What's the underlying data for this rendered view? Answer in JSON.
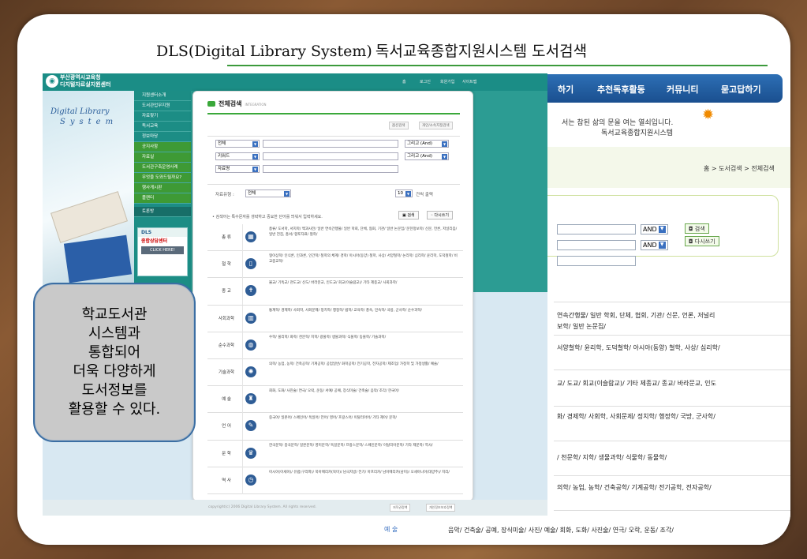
{
  "slide": {
    "title_en": "DLS(Digital Library System)",
    "title_ko": "독서교육종합지원시스템 도서검색"
  },
  "background_site": {
    "nav": [
      "하기",
      "추천독후활동",
      "커뮤니티",
      "묻고답하기"
    ],
    "greeting_line1": "서는 참된 삶의 문을 여는 열쇠입니다.",
    "greeting_line2": "독서교육종합지원시스템",
    "breadcrumb": "홈 > 도서검색 > 전체검색",
    "and_label": "AND",
    "search_btn": "검색",
    "rewrite_btn": "다시쓰기",
    "rows": [
      "연속간행물/ 일반 학회, 단체, 협회, 기관/ 신문, 언론, 저널리",
      "보학/ 일반 논문집/",
      "서양철학/ 윤리학, 도덕철학/ 아시아(동양) 철학, 사상/ 심리학/",
      "교/ 도교/ 회교(이슬람교)/ 기타 제종교/ 종교/ 바라문교, 인도",
      "화/ 경제학/ 사회학, 사회문제/ 정치학/ 행정학/ 국방, 군사학/",
      "/ 천문학/ 지학/ 생물과학/ 식물학/ 동물학/",
      "의학/ 농업, 농학/ 건축공학/ 기계공학/ 전기공학, 전자공학/"
    ],
    "art_label": "예 술",
    "art_row": "음악/ 건축술/ 공예, 장식미술/ 사진/ 예술/ 회화, 도화/ 사진술/ 연극/ 오락, 운동/ 조각/"
  },
  "screenshot": {
    "logo_line1": "부산광역시교육청",
    "logo_line2": "디지털자료실지원센터",
    "utility_links": [
      "홈",
      "로그인",
      "회원가입",
      "사이트맵"
    ],
    "hero_line1": "Digital Library",
    "hero_line2": "System",
    "menu_main": [
      "지원센터소개",
      "도서관업무지원",
      "자료찾기",
      "독서교육",
      "정보마당"
    ],
    "menu_sub": [
      "공지사항",
      "자료실",
      "도서관구축운영사례",
      "무엇을 도와드릴까요?",
      "행사게시판",
      "플랜터",
      "토론방"
    ],
    "dls_title": "DLS",
    "dls_sub": "종합상담센터",
    "dls_click": "CLICK HERE!",
    "popup": {
      "title": "전체검색",
      "subtitle": "INTEGRATION",
      "tool_btn1": "옵션검색",
      "tool_btn2": "개인/소속지정검색",
      "field1": "전체",
      "field2": "키워드",
      "field3": "자료명",
      "op1": "그리고 (And)",
      "op2": "그리고 (And)",
      "type_label": "자료유형 :",
      "type_value": "전체",
      "count_value": "10",
      "count_suffix": "건씩 출력",
      "note": "• 검색어는 특수문자를 생략하고 중요한 단어를 띄워서 입력하세요.",
      "search_btn": "검색",
      "rewrite_btn": "다시쓰기",
      "categories": [
        {
          "name": "총 류",
          "icon": "▦",
          "desc": "총류/ 도서학, 서지학/ 백과사전/ 일반 연속간행물/ 일반 학회, 단체, 협회, 기관/ 일반 논문집/ 문헌정보학/ 신문, 언론, 저널리즘/ 일반 전집, 총서/ 향토자료/ 철학/"
        },
        {
          "name": "철 학",
          "icon": "▯",
          "desc": "형이상학/ 인식론, 인과론, 인간학/ 철학의 체계/ 경학/ 아시아(동양) 철학, 사상/ 서양철학/ 논리학/ 심리학/ 윤리학, 도덕철학/ 비교종교학/"
        },
        {
          "name": "종 교",
          "icon": "✝",
          "desc": "불교/ 기독교/ 천도교/ 신도/ 바라문교, 인도교/ 회교(이슬람교)/ 기타 제종교/ 사회과학/"
        },
        {
          "name": "사회과학",
          "icon": "▥",
          "desc": "통계학/ 경제학/ 사회학, 사회문제/ 정치학/ 행정학/ 법학/ 교육학/ 풍속, 민속학/ 국방, 군사학/ 순수과학/"
        },
        {
          "name": "순수과학",
          "icon": "◍",
          "desc": "수학/ 물리학/ 화학/ 천문학/ 지학/ 광물학/ 생물과학/ 식물학/ 동물학/ 기술과학/"
        },
        {
          "name": "기술과학",
          "icon": "✺",
          "desc": "의학/ 농업, 농학/ 건축공학/ 기계공학/ 공업일반/ 화학공학/ 전기공학, 전자공학/ 제조업/ 가정학 및 가정생활/ 예술/"
        },
        {
          "name": "예 술",
          "icon": "♜",
          "desc": "회화, 도화/ 사진술/ 연극/ 오락, 운동/ 서예/ 공예, 장식미술/ 건축술/ 음악/ 조각/ 한국어/"
        },
        {
          "name": "언 어",
          "icon": "✎",
          "desc": "중국어/ 일본어/ 스페인어/ 독일어/ 언어/ 영어/ 프랑스어/ 이탈리아어/ 기타 제어/ 문학/"
        },
        {
          "name": "문 학",
          "icon": "♛",
          "desc": "한국문학/ 중국문학/ 일본문학/ 영미문학/ 독일문학/ 프랑스문학/ 스페인문학/ 이탈리아문학/ 기타 제문학/ 역사/"
        },
        {
          "name": "역 사",
          "icon": "◷",
          "desc": "아시아(아세아)/ 유럽(구라파)/ 북아메리카(북미)/ 남극지방/ 전기/ 아프리카/ 남아메리카(남미)/ 오세아니아(대양주)/ 지리/"
        }
      ]
    },
    "footer_copyright": "copyright(c) 2006 Digital Library System. All rights reserved.",
    "footer_btn1": "저작권정책",
    "footer_btn2": "개인정보보호정책"
  },
  "callout": {
    "lines": [
      "학교도서관",
      "시스템과",
      "통합되어",
      "더욱 다양하게",
      "도서정보를",
      "활용할 수 있다."
    ]
  }
}
